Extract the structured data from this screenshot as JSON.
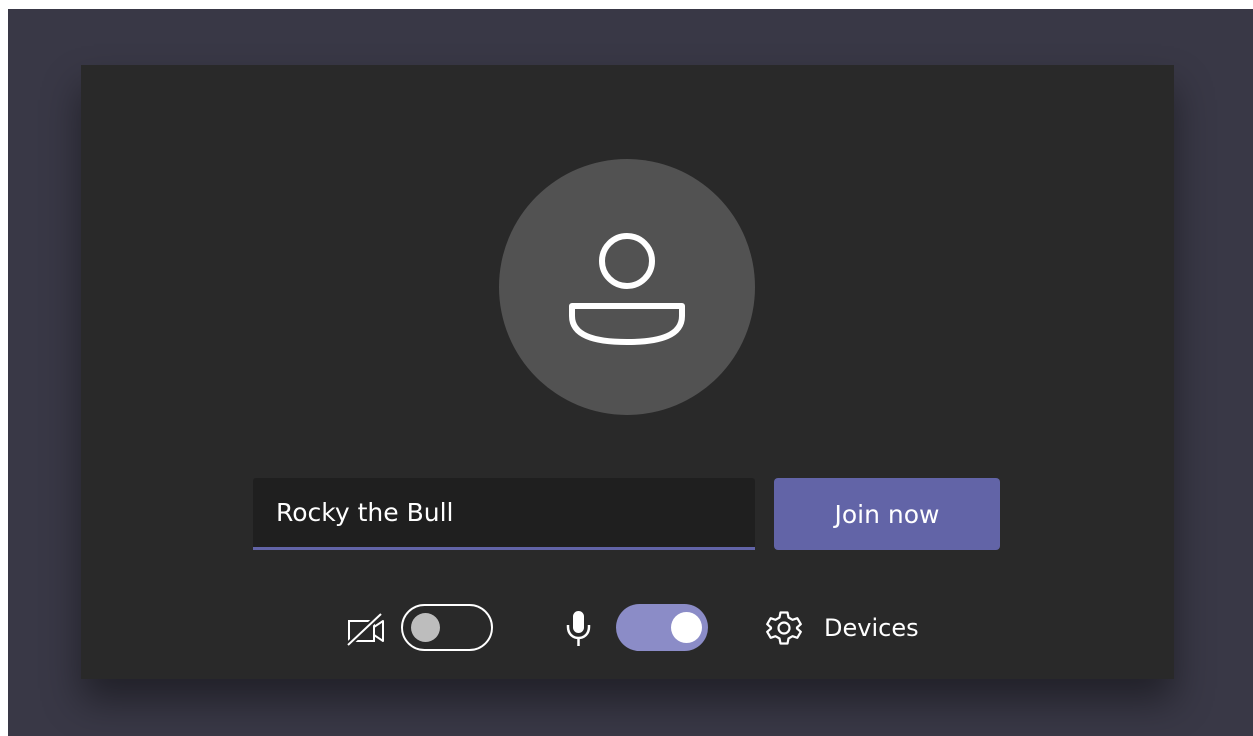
{
  "prejoin": {
    "display_name": "Rocky the Bull",
    "join_button_label": "Join now",
    "controls": {
      "camera": {
        "icon": "camera-off-icon",
        "enabled": false
      },
      "microphone": {
        "icon": "microphone-icon",
        "enabled": true
      },
      "devices": {
        "icon": "gear-icon",
        "label": "Devices"
      }
    }
  },
  "colors": {
    "app_background": "#393846",
    "panel_background": "#292929",
    "avatar_background": "#525252",
    "input_background": "#1f1f1f",
    "accent": "#6264a7",
    "toggle_on": "#8b8cc7",
    "toggle_off_knob": "#bdbdbd",
    "text": "#ffffff"
  }
}
